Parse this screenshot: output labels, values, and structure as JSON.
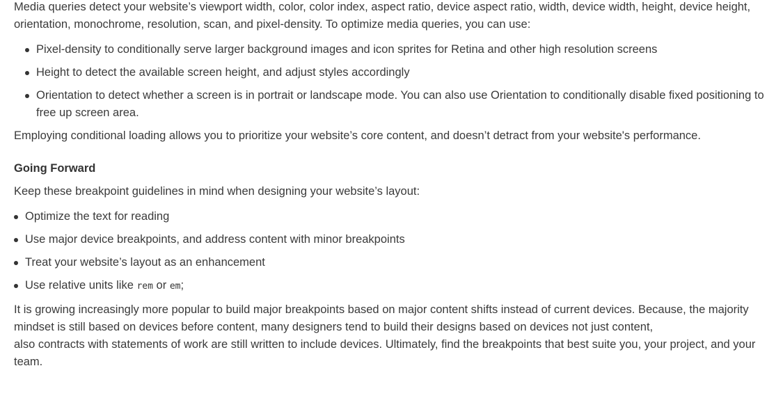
{
  "intro": "Media queries detect your website’s viewport width, color, color index, aspect ratio, device aspect ratio, width, device width, height, device height, orientation, monochrome, resolution, scan, and pixel-density. To optimize media queries, you can use:",
  "optimize_list": [
    "Pixel-density to conditionally serve larger background images and icon sprites for Retina and other high resolution screens",
    "Height to detect the available screen height, and adjust styles accordingly",
    "Orientation to detect whether a screen is in portrait or landscape mode. You can also use Orientation to conditionally disable fixed positioning to free up screen area."
  ],
  "conditional_loading": "Employing conditional loading allows you to prioritize your website’s core content, and doesn’t detract from your website's performance.",
  "section_heading": "Going Forward",
  "keep_in_mind": "Keep these breakpoint guidelines in mind when designing your website’s layout:",
  "guidelines": [
    "Optimize the text for reading",
    "Use major device breakpoints, and address content with minor breakpoints",
    "Treat your website’s layout as an enhancement"
  ],
  "units_item": {
    "prefix": "Use relative units like ",
    "unit_1": "rem",
    "joiner": " or ",
    "unit_2": "em",
    "suffix": ";"
  },
  "closing_line_1": "It is growing increasingly more popular to build major breakpoints based on major content shifts instead of current devices. Because, the majority mindset is still based on devices before content, many designers tend to build their designs based on devices not just content,",
  "closing_line_2": "also contracts with statements of work are still written to include devices. Ultimately, find the breakpoints that best suite you, your project, and your team."
}
